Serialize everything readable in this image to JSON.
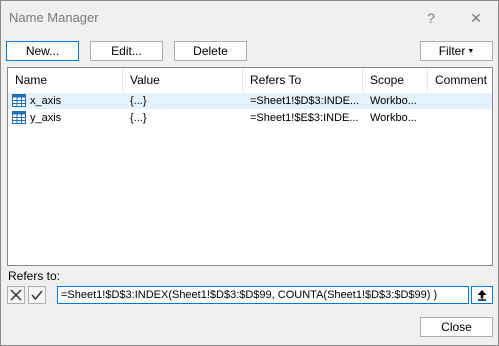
{
  "window": {
    "title": "Name Manager",
    "help_glyph": "?",
    "close_glyph": "✕"
  },
  "toolbar": {
    "new_label": "New...",
    "edit_label": "Edit...",
    "delete_label": "Delete",
    "filter_label": "Filter"
  },
  "table": {
    "columns": [
      "Name",
      "Value",
      "Refers To",
      "Scope",
      "Comment"
    ],
    "rows": [
      {
        "name": "x_axis",
        "value": "{...}",
        "refers_to": "=Sheet1!$D$3:INDE...",
        "scope": "Workbo...",
        "comment": ""
      },
      {
        "name": "y_axis",
        "value": "{...}",
        "refers_to": "=Sheet1!$E$3:INDE...",
        "scope": "Workbo...",
        "comment": ""
      }
    ]
  },
  "refers_to": {
    "label": "Refers to:",
    "value": "=Sheet1!$D$3:INDEX(Sheet1!$D$3:$D$99, COUNTA(Sheet1!$D$3:$D$99) )"
  },
  "footer": {
    "close_label": "Close"
  },
  "colors": {
    "accent": "#0078d7",
    "selection": "#e5f1fb"
  }
}
